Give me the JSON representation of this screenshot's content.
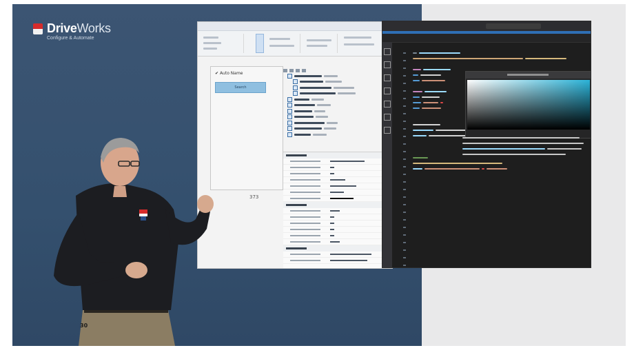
{
  "brand": {
    "name_bold": "Drive",
    "name_light": "Works",
    "tagline": "Configure & Automate",
    "colors": {
      "red": "#d62b2b",
      "navy": "#34506e"
    }
  },
  "designer": {
    "checkbox_label": "Auto Name",
    "button_label": "Search",
    "canvas_number": "373"
  },
  "presenter": {
    "shirt_logo": "DriveWorks",
    "belt_badge": "30"
  }
}
